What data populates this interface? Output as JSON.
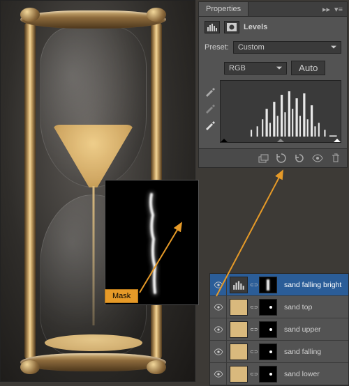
{
  "properties": {
    "panel_title_tab": "Properties",
    "adjustment_name": "Levels",
    "preset_label": "Preset:",
    "preset_value": "Custom",
    "channel_value": "RGB",
    "auto_label": "Auto"
  },
  "layers": [
    {
      "name": "sand falling bright",
      "selected": true,
      "thumb_type": "adj",
      "mask": "smudge"
    },
    {
      "name": "sand top",
      "selected": false,
      "thumb_type": "sand",
      "mask": "dot"
    },
    {
      "name": "sand upper",
      "selected": false,
      "thumb_type": "sand",
      "mask": "dot"
    },
    {
      "name": "sand falling",
      "selected": false,
      "thumb_type": "sand",
      "mask": "dot"
    },
    {
      "name": "sand lower",
      "selected": false,
      "thumb_type": "sand",
      "mask": "dot"
    }
  ],
  "annotation": {
    "mask_label": "Mask"
  }
}
